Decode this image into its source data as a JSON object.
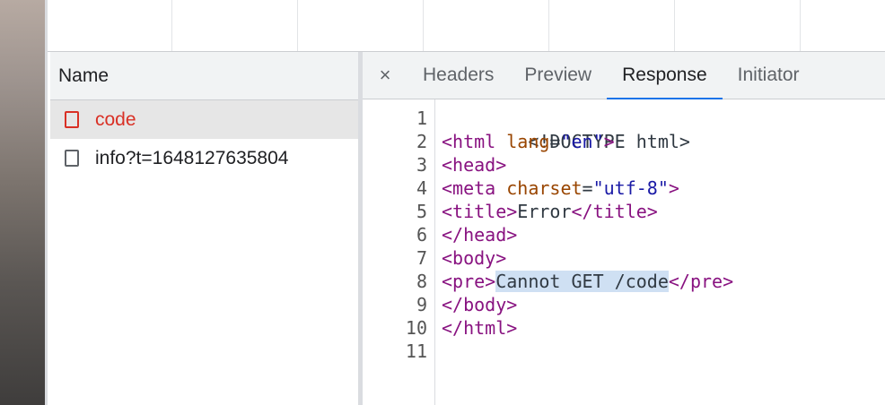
{
  "network": {
    "name_header": "Name",
    "requests": [
      {
        "name": "code",
        "selected": true
      },
      {
        "name": "info?t=1648127635804",
        "selected": false
      }
    ]
  },
  "detail_tabs": {
    "close_glyph": "×",
    "tabs": [
      "Headers",
      "Preview",
      "Response",
      "Initiator"
    ],
    "active": "Response"
  },
  "response": {
    "line_numbers": [
      "1",
      "2",
      "3",
      "4",
      "5",
      "6",
      "7",
      "8",
      "9",
      "10",
      "11"
    ],
    "lines": {
      "l1": "<!DOCTYPE html>",
      "l2_open": "<html ",
      "l2_attr": "lang",
      "l2_eq": "=",
      "l2_val": "\"en\"",
      "l2_close": ">",
      "l3": "<head>",
      "l4_open": "<meta ",
      "l4_attr": "charset",
      "l4_eq": "=",
      "l4_val": "\"utf-8\"",
      "l4_close": ">",
      "l5_open": "<title>",
      "l5_text": "Error",
      "l5_close": "</title>",
      "l6": "</head>",
      "l7": "<body>",
      "l8_open": "<pre>",
      "l8_text": "Cannot GET /code",
      "l8_close": "</pre>",
      "l9": "</body>",
      "l10": "</html>"
    }
  },
  "colors": {
    "selected_request": "#d93025",
    "active_tab_underline": "#1a73e8",
    "tag": "#881280",
    "attribute": "#994500",
    "value": "#1a1aa6",
    "selection_highlight": "#cfe0f3"
  }
}
